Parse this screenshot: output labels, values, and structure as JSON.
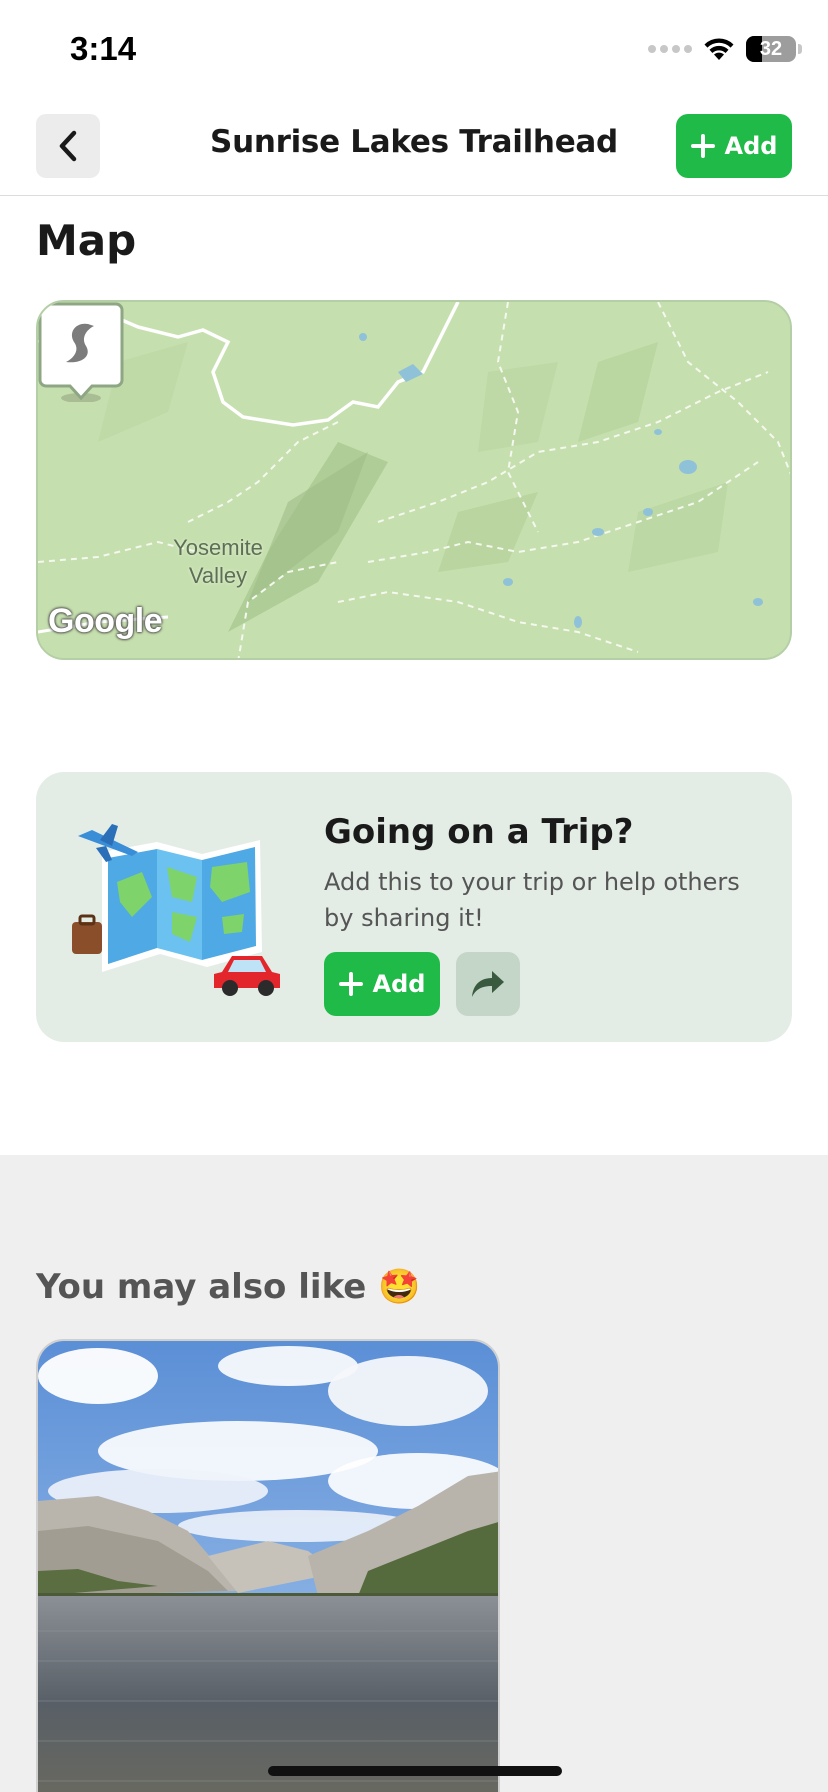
{
  "status_bar": {
    "time": "3:14",
    "battery_level": "32",
    "battery_fraction": 0.32,
    "icons": [
      "signal-dots-icon",
      "wifi-icon",
      "battery-icon"
    ]
  },
  "header": {
    "title": "Sunrise Lakes Trailhead",
    "back_icon": "chevron-left-icon",
    "add_label": "Add",
    "add_icon": "plus-icon"
  },
  "map": {
    "section_title": "Map",
    "place_label_line1": "Yosemite",
    "place_label_line2": "Valley",
    "attribution": "Google",
    "pin_icon": "map-pin-icon"
  },
  "trip_card": {
    "title": "Going on a Trip?",
    "description": "Add this to your trip or help others by sharing it!",
    "add_label": "Add",
    "share_icon": "share-arrow-icon",
    "illustration": "travel-map-illustration"
  },
  "recommendations": {
    "title": "You may also like 🤩",
    "card_image": "mountain-lake-photo"
  },
  "colors": {
    "accent_green": "#1fba47",
    "map_background": "#c6dfae",
    "trip_card_background": "#e3ede6",
    "recommend_background": "#efefef"
  }
}
